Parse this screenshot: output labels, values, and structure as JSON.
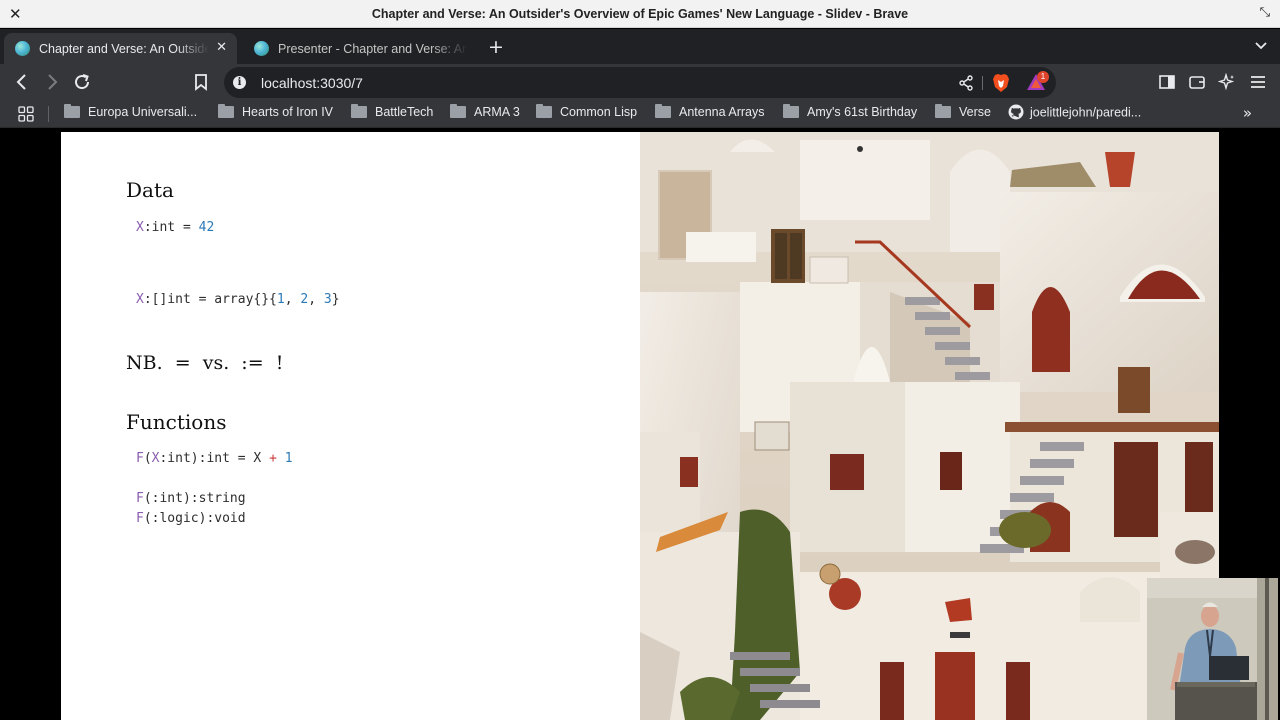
{
  "window": {
    "title": "Chapter and Verse: An Outsider's Overview of Epic Games' New Language - Slidev - Brave"
  },
  "tabs": [
    {
      "title": "Chapter and Verse: An Outsider's Overview of Epic Games' New Language - Slidev",
      "active": true
    },
    {
      "title": "Presenter - Chapter and Verse: An Outsider's Overview",
      "active": false
    }
  ],
  "address_bar": {
    "url": "localhost:3030/7",
    "rewards_badge": "1"
  },
  "bookmarks": [
    {
      "label": "Europa Universali...",
      "icon": "folder-icon"
    },
    {
      "label": "Hearts of Iron IV",
      "icon": "folder-icon"
    },
    {
      "label": "BattleTech",
      "icon": "folder-icon"
    },
    {
      "label": "ARMA 3",
      "icon": "folder-icon"
    },
    {
      "label": "Common Lisp",
      "icon": "folder-icon"
    },
    {
      "label": "Antenna Arrays",
      "icon": "folder-icon"
    },
    {
      "label": "Amy's 61st Birthday",
      "icon": "folder-icon"
    },
    {
      "label": "Verse",
      "icon": "folder-icon"
    },
    {
      "label": "joelittlejohn/paredi...",
      "icon": "github-icon"
    }
  ],
  "slide": {
    "data_heading": "Data",
    "code_data_1": [
      {
        "t": "X",
        "c": "id"
      },
      {
        "t": ":int = ",
        "c": "plain"
      },
      {
        "t": "42",
        "c": "num"
      }
    ],
    "code_data_2": [
      {
        "t": "X",
        "c": "id"
      },
      {
        "t": ":[]int = array{}{",
        "c": "plain"
      },
      {
        "t": "1",
        "c": "num"
      },
      {
        "t": ", ",
        "c": "plain"
      },
      {
        "t": "2",
        "c": "num"
      },
      {
        "t": ", ",
        "c": "plain"
      },
      {
        "t": "3",
        "c": "num"
      },
      {
        "t": "}",
        "c": "plain"
      }
    ],
    "note": "NB.  =  vs.  :=  !",
    "functions_heading": "Functions",
    "code_fn_1": [
      {
        "t": "F",
        "c": "id"
      },
      {
        "t": "(",
        "c": "plain"
      },
      {
        "t": "X",
        "c": "id"
      },
      {
        "t": ":int):int = X ",
        "c": "plain"
      },
      {
        "t": "+",
        "c": "op"
      },
      {
        "t": " ",
        "c": "plain"
      },
      {
        "t": "1",
        "c": "num"
      }
    ],
    "code_fn_2": [
      {
        "t": "F",
        "c": "id"
      },
      {
        "t": "(:int):string",
        "c": "plain"
      }
    ],
    "code_fn_3": [
      {
        "t": "F",
        "c": "id"
      },
      {
        "t": "(:logic):void",
        "c": "plain"
      }
    ],
    "image": "santorini-white-buildings-photo"
  },
  "colors": {
    "identifier": "#8a5db0",
    "number": "#2b7ab8",
    "operator": "#c83a3a"
  }
}
